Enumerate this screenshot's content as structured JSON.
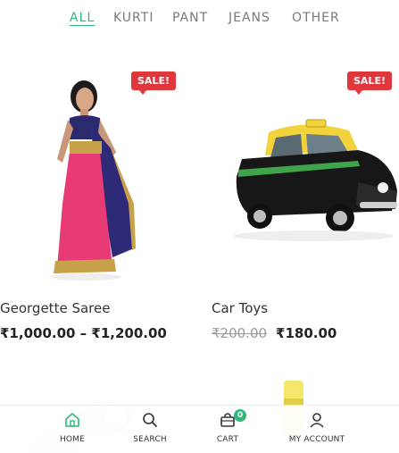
{
  "filters": [
    {
      "label": "ALL",
      "active": true
    },
    {
      "label": "KURTI",
      "active": false
    },
    {
      "label": "PANT",
      "active": false
    },
    {
      "label": "JEANS",
      "active": false
    },
    {
      "label": "OTHER",
      "active": false
    }
  ],
  "products": [
    {
      "badge": "SALE!",
      "title": "Georgette Saree",
      "price_range": "₹1,000.00 – ₹1,200.00",
      "image": "saree-photo"
    },
    {
      "badge": "SALE!",
      "title": "Car Toys",
      "price_old": "₹200.00",
      "price_new": "₹180.00",
      "image": "taxi-car-photo"
    }
  ],
  "bottom_nav": {
    "home": {
      "label": "HOME",
      "icon": "home-icon",
      "active": true
    },
    "search": {
      "label": "SEARCH",
      "icon": "search-icon"
    },
    "cart": {
      "label": "CART",
      "icon": "cart-icon",
      "count": "0"
    },
    "account": {
      "label": "MY ACCOUNT",
      "icon": "user-icon"
    }
  },
  "colors": {
    "accent": "#2fb878",
    "sale": "#e0373d",
    "text": "#333333",
    "muted": "#7a7a7a"
  }
}
